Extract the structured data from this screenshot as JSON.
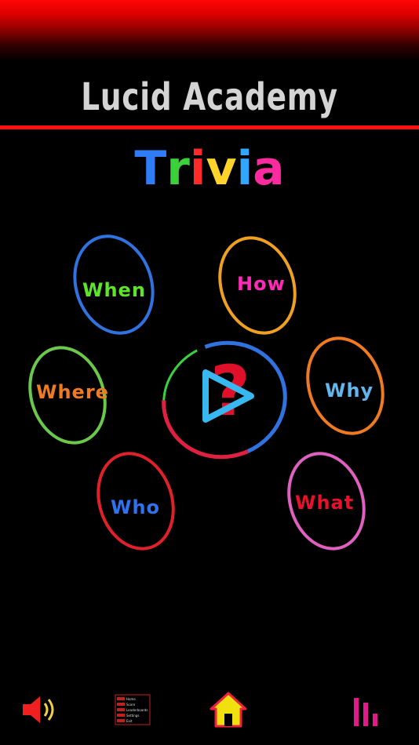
{
  "app": {
    "title": "Lucid Academy",
    "subtitle_letters": [
      {
        "ch": "T",
        "color": "#2f7cf5"
      },
      {
        "ch": "r",
        "color": "#3ad13a"
      },
      {
        "ch": "i",
        "color": "#ff2a2a"
      },
      {
        "ch": "v",
        "color": "#ffd42a"
      },
      {
        "ch": "i",
        "color": "#2fa6ff"
      },
      {
        "ch": "a",
        "color": "#ff2aa0"
      }
    ]
  },
  "rings": {
    "when": {
      "label": "When",
      "label_color": "#5ce62a",
      "ring_color": "#2f72e0"
    },
    "how": {
      "label": "How",
      "label_color": "#ff2ab8",
      "ring_color": "#f0a020"
    },
    "where": {
      "label": "Where",
      "label_color": "#f07a20",
      "ring_color": "#6ac94a"
    },
    "why": {
      "label": "Why",
      "label_color": "#62b6ee",
      "ring_color": "#f07a20"
    },
    "who": {
      "label": "Who",
      "label_color": "#2f72f0",
      "ring_color": "#e0202a"
    },
    "what": {
      "label": "What",
      "label_color": "#e8102a",
      "ring_color": "#e060c0"
    }
  },
  "center": {
    "symbol": "?",
    "play_color": "#38b8f0",
    "ring_colors": [
      "#2f72e0",
      "#e02040",
      "#3ad13a"
    ]
  },
  "bottom_bar": {
    "sound_icon": "speaker-icon",
    "menu_icon": "menu-list-icon",
    "menu_items": [
      "Home",
      "Score",
      "Leaderboards",
      "Settings",
      "Exit"
    ],
    "home_icon": "home-icon",
    "stats_icon": "stats-icon",
    "colors": {
      "sound": "#f02020",
      "menu": "#c02020",
      "home_fill": "#f0e010",
      "home_roof": "#f02040",
      "stats": "#e01a8a"
    }
  }
}
